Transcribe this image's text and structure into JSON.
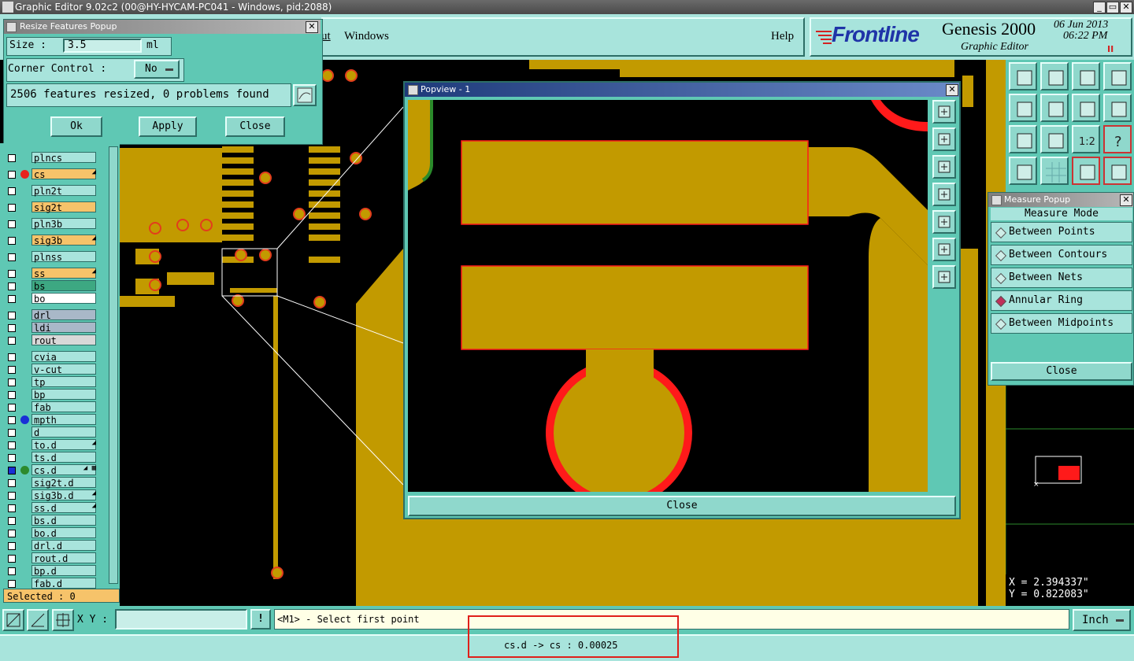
{
  "app": {
    "title": "Graphic Editor 9.02c2 (00@HY-HYCAM-PC041 - Windows, pid:2088)",
    "min": "_",
    "max": "▭",
    "close": "✕"
  },
  "menu": {
    "partial_item": "ut",
    "windows": "Windows",
    "help": "Help"
  },
  "brand": {
    "logo": "Frontline",
    "product": "Genesis 2000",
    "subtitle": "Graphic Editor",
    "date": "06 Jun 2013",
    "time": "06:22 PM",
    "pause": "II"
  },
  "resize_popup": {
    "title": "Resize Features Popup",
    "size_label": "Size :",
    "size_value": "3.5",
    "size_unit": "ml",
    "corner_label": "Corner Control :",
    "corner_value": "No",
    "status": "2506 features resized, 0 problems found",
    "ok": "Ok",
    "apply": "Apply",
    "close": "Close"
  },
  "layers": [
    {
      "name": "plncs",
      "color": "#a8e4dc",
      "dot": "",
      "flag": ""
    },
    {
      "name": "cs",
      "color": "#f6c36a",
      "dot": "#e8231c",
      "flag": "◢"
    },
    {
      "name": "pln2t",
      "color": "#a8e4dc",
      "dot": "",
      "flag": ""
    },
    {
      "name": "sig2t",
      "color": "#f6c36a",
      "dot": "",
      "flag": ""
    },
    {
      "name": "pln3b",
      "color": "#a8e4dc",
      "dot": "",
      "flag": ""
    },
    {
      "name": "sig3b",
      "color": "#f6c36a",
      "dot": "",
      "flag": "◢"
    },
    {
      "name": "plnss",
      "color": "#a8e4dc",
      "dot": "",
      "flag": ""
    },
    {
      "name": "ss",
      "color": "#f6c36a",
      "dot": "",
      "flag": "◢"
    },
    {
      "name": "bs",
      "color": "#3da882",
      "dot": "",
      "flag": ""
    },
    {
      "name": "bo",
      "color": "#ffffff",
      "dot": "",
      "flag": ""
    },
    {
      "name": "drl",
      "color": "#a9b8c8",
      "dot": "",
      "flag": ""
    },
    {
      "name": "ldi",
      "color": "#a9b8c8",
      "dot": "",
      "flag": ""
    },
    {
      "name": "rout",
      "color": "#d8d8d8",
      "dot": "",
      "flag": ""
    },
    {
      "name": "cvia",
      "color": "#a8e4dc",
      "dot": "",
      "flag": ""
    },
    {
      "name": "v-cut",
      "color": "#a8e4dc",
      "dot": "",
      "flag": ""
    },
    {
      "name": "tp",
      "color": "#a8e4dc",
      "dot": "",
      "flag": ""
    },
    {
      "name": "bp",
      "color": "#a8e4dc",
      "dot": "",
      "flag": ""
    },
    {
      "name": "fab",
      "color": "#a8e4dc",
      "dot": "",
      "flag": ""
    },
    {
      "name": "mpth",
      "color": "#a8e4dc",
      "dot": "#1a2fd6",
      "flag": ""
    },
    {
      "name": "d",
      "color": "#a8e4dc",
      "dot": "",
      "flag": ""
    },
    {
      "name": "to.d",
      "color": "#a8e4dc",
      "dot": "",
      "flag": "◢"
    },
    {
      "name": "ts.d",
      "color": "#a8e4dc",
      "dot": "",
      "flag": ""
    },
    {
      "name": "cs.d",
      "color": "#a8e4dc",
      "dot": "#2d8a2d",
      "flag": "◢ ▦"
    },
    {
      "name": "sig2t.d",
      "color": "#a8e4dc",
      "dot": "",
      "flag": ""
    },
    {
      "name": "sig3b.d",
      "color": "#a8e4dc",
      "dot": "",
      "flag": "◢"
    },
    {
      "name": "ss.d",
      "color": "#a8e4dc",
      "dot": "",
      "flag": "◢"
    },
    {
      "name": "bs.d",
      "color": "#a8e4dc",
      "dot": "",
      "flag": ""
    },
    {
      "name": "bo.d",
      "color": "#a8e4dc",
      "dot": "",
      "flag": ""
    },
    {
      "name": "drl.d",
      "color": "#a8e4dc",
      "dot": "",
      "flag": ""
    },
    {
      "name": "rout.d",
      "color": "#a8e4dc",
      "dot": "",
      "flag": ""
    },
    {
      "name": "bp.d",
      "color": "#a8e4dc",
      "dot": "",
      "flag": ""
    },
    {
      "name": "fab.d",
      "color": "#a8e4dc",
      "dot": "",
      "flag": ""
    }
  ],
  "selected": "Selected : 0",
  "popview": {
    "title": "Popview - 1",
    "close": "Close"
  },
  "measure": {
    "title": "Measure Popup",
    "mode_label": "Measure Mode",
    "items": [
      {
        "label": "Between Points",
        "selected": false
      },
      {
        "label": "Between Contours",
        "selected": false
      },
      {
        "label": "Between Nets",
        "selected": false
      },
      {
        "label": "Annular Ring",
        "selected": true
      },
      {
        "label": "Between Midpoints",
        "selected": false
      }
    ],
    "close": "Close"
  },
  "coords": {
    "x": "X = 2.394337\"",
    "y": "Y = 0.822083\""
  },
  "bottom": {
    "xy_label": "X Y :",
    "xy_value": "",
    "alert": "!",
    "prompt": "<M1> - Select first point",
    "units": "Inch",
    "status": "cs.d -> cs : 0.00025"
  },
  "toolbar_icons": [
    "zoom-home-icon",
    "zoom-down-icon",
    "home-icon",
    "split-window-icon",
    "panel-left-icon",
    "panel-right-icon",
    "swap-icon",
    "snake-icon",
    "fit-icon",
    "center-icon",
    "one-to-one-icon",
    "help-icon",
    "tools-icon",
    "grid-icon",
    "net-left-icon",
    "net-right-icon"
  ],
  "colors": {
    "copper": "#c29a00",
    "board": "#000000",
    "ring": "#ff1a1a",
    "panel": "#5fc8b4",
    "highlight": "#f6c36a"
  }
}
